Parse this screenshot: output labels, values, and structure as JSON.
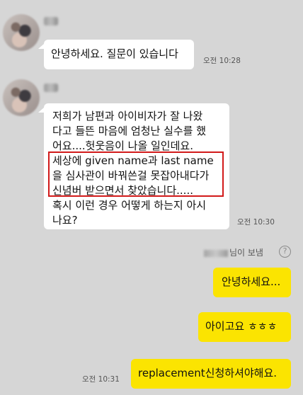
{
  "messages": {
    "m1": {
      "text": "안녕하세요. 질문이 있습니다",
      "time": "오전 10:28"
    },
    "m2": {
      "lines": [
        "저희가 남편과 아이비자가 잘 나왔",
        "다고 들뜬 마음에 엄청난 실수를 했",
        "어요....헛웃음이 나올 일인데요.",
        "세상에 given name과 last name",
        "을 심사관이 바꿔쓴걸 못잡아내다가",
        "신념버 받으면서 찾았습니다.....",
        "혹시 이런 경우 어떻게 하는지 아시",
        "나요?"
      ],
      "time": "오전 10:30"
    }
  },
  "read_notice": {
    "suffix": "님이 보냄",
    "help": "?"
  },
  "outgoing": {
    "o1": "안녕하세요...",
    "o2": "아이고요 ㅎㅎㅎ",
    "o3": "replacement신청하셔야해요.",
    "time": "오전 10:31"
  },
  "colors": {
    "background": "#d6d6d6",
    "my_bubble": "#fbe401",
    "their_bubble": "#ffffff",
    "highlight_box": "#d21a1a"
  }
}
